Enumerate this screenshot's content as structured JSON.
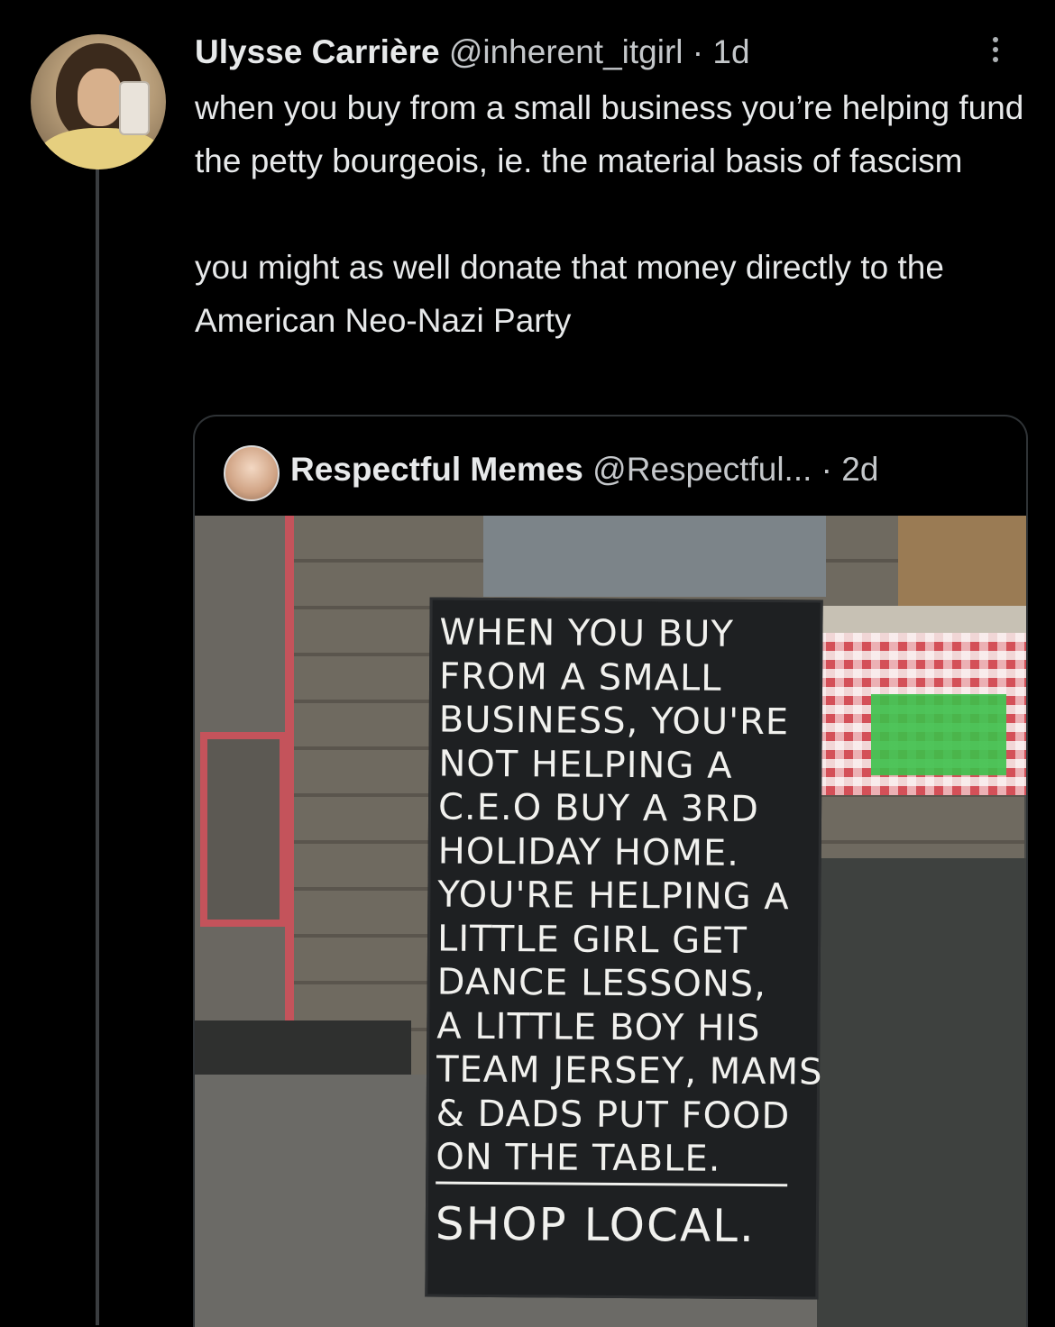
{
  "tweet": {
    "author_name": "Ulysse Carrière",
    "handle": "@inherent_itgirl",
    "separator": "·",
    "time": "1d",
    "paragraphs": [
      "when you buy from a small business you’re helping fund the petty bourgeois, ie. the material basis of fascism",
      "you might as well donate that money directly to the American Neo-Nazi Party"
    ]
  },
  "quote": {
    "author_name": "Respectful Memes",
    "handle": "@Respectful...",
    "separator": "·",
    "time": "2d",
    "sign_lines": [
      "WHEN YOU BUY",
      "FROM A SMALL",
      "BUSINESS, YOU'RE",
      "NOT HELPING A",
      "C.E.O BUY A 3RD",
      "HOLIDAY HOME.",
      "YOU'RE HELPING A",
      "LITTLE GIRL GET",
      "DANCE LESSONS,",
      "A LITTLE BOY HIS",
      "TEAM JERSEY, MAMS",
      "& DADS PUT FOOD",
      "ON THE TABLE."
    ],
    "sign_cta": "SHOP LOCAL."
  },
  "icons": {
    "more": "more-vertical-icon"
  }
}
